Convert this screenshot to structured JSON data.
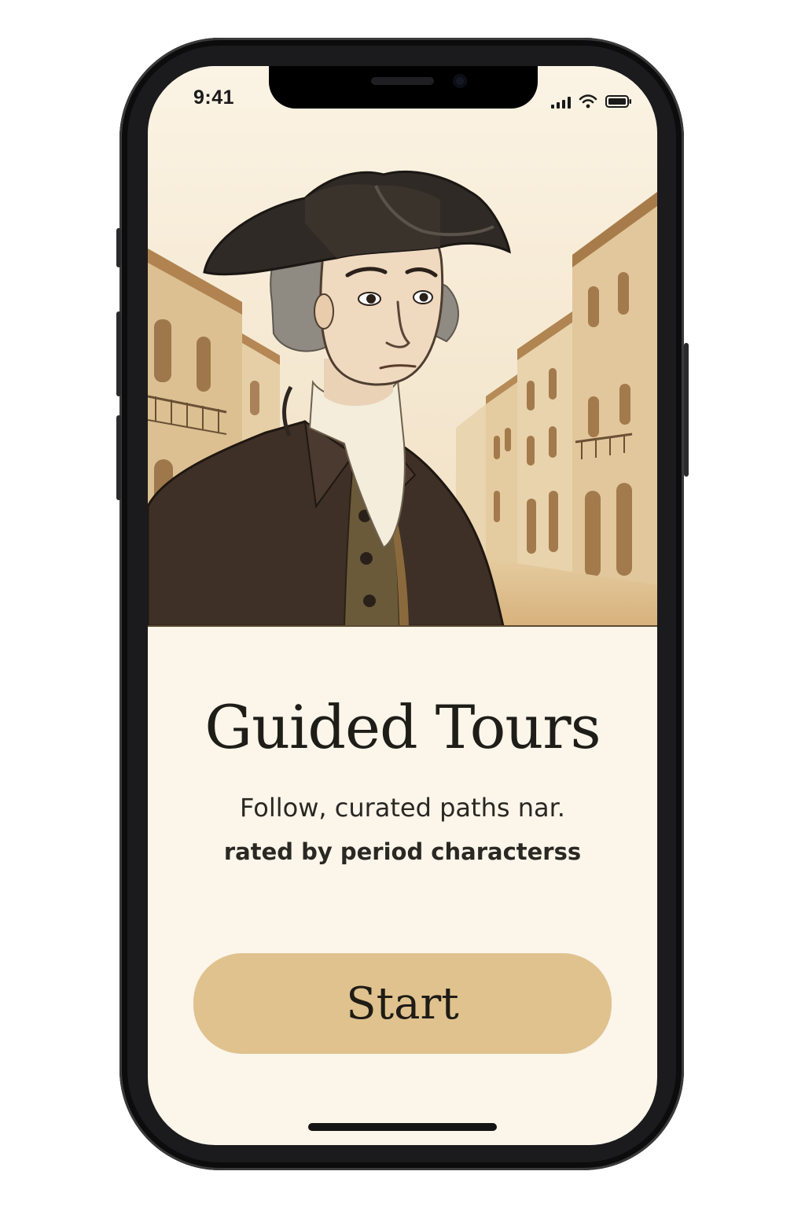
{
  "status_bar": {
    "time": "9:41",
    "icons": [
      "cellular-signal-icon",
      "wifi-icon",
      "battery-icon"
    ]
  },
  "hero": {
    "illustration": "period-character-portrait-on-old-town-street"
  },
  "content": {
    "title": "Guided Tours",
    "subtitle_line1": "Follow, curated paths nar.",
    "subtitle_line2": "rated by period characterss"
  },
  "start_button": {
    "label": "Start"
  },
  "colors": {
    "background": "#fbf5ea",
    "button": "#e0c28f",
    "text": "#1e1d18",
    "frame": "#1b1b1d"
  }
}
